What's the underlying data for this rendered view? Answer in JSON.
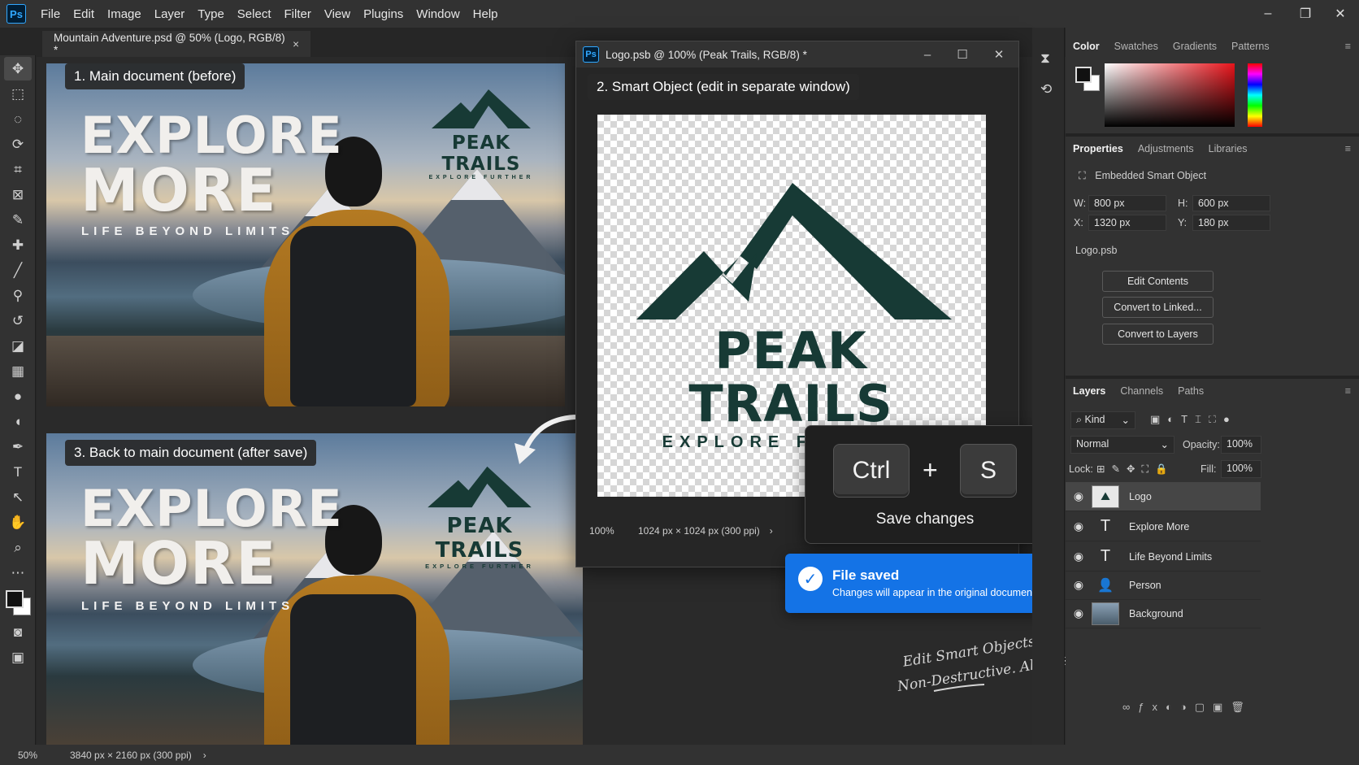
{
  "app": {
    "logo": "Ps",
    "menu": [
      "File",
      "Edit",
      "Image",
      "Layer",
      "Type",
      "Select",
      "Filter",
      "View",
      "Plugins",
      "Window",
      "Help"
    ],
    "window_controls": {
      "minimize": "–",
      "restore": "❐",
      "close": "✕"
    }
  },
  "main_doc": {
    "tab_title": "Mountain Adventure.psd @ 50% (Logo, RGB/8) *",
    "tab_close": "×",
    "label_before": "1. Main document (before)",
    "label_after": "3. Back to main document (after save)",
    "headline_1": "EXPLORE",
    "headline_2": "MORE",
    "tagline": "LIFE BEYOND LIMITS",
    "logo_title": "PEAK TRAILS",
    "logo_sub": "EXPLORE FURTHER",
    "status_zoom": "50%",
    "status_size": "3840 px × 2160 px (300 ppi)",
    "status_arrow": "›"
  },
  "smart_object": {
    "title": "Logo.psb @ 100% (Peak Trails, RGB/8) *",
    "label": "2. Smart Object (edit in separate window)",
    "logo_title": "PEAK TRAILS",
    "logo_sub": "EXPLORE FURTHER",
    "status_zoom": "100%",
    "status_size": "1024 px × 1024 px (300 ppi)",
    "status_arrow": "›",
    "controls": {
      "minimize": "–",
      "restore": "☐",
      "close": "✕"
    }
  },
  "shortcut": {
    "key1": "Ctrl",
    "plus": "+",
    "key2": "S",
    "caption": "Save changes"
  },
  "toast": {
    "title": "File saved",
    "message": "Changes will appear in the original document.",
    "icon": "check-icon",
    "color": "#1473e6"
  },
  "handwriting": {
    "line1": "Edit Smart Objects",
    "line2": "Non-Destructive. Always."
  },
  "panels": {
    "color_tabs": [
      "Color",
      "Swatches",
      "Gradients",
      "Patterns"
    ],
    "props_tabs": [
      "Properties",
      "Adjustments",
      "Libraries"
    ],
    "props": {
      "type": "Embedded Smart Object",
      "w_label": "W:",
      "w_value": "800 px",
      "h_label": "H:",
      "h_value": "600 px",
      "x_label": "X:",
      "x_value": "1320 px",
      "y_label": "Y:",
      "y_value": "180 px",
      "file": "Logo.psb",
      "buttons": [
        "Edit Contents",
        "Convert to Linked...",
        "Convert to Layers"
      ]
    },
    "layers_tabs": [
      "Layers",
      "Channels",
      "Paths"
    ],
    "layers": {
      "filter_kind": "Kind",
      "blend_mode": "Normal",
      "opacity_label": "Opacity:",
      "opacity_value": "100%",
      "lock_label": "Lock:",
      "fill_label": "Fill:",
      "fill_value": "100%",
      "items": [
        {
          "name": "Logo",
          "kind": "smart"
        },
        {
          "name": "Explore More",
          "kind": "text"
        },
        {
          "name": "Life Beyond Limits",
          "kind": "text"
        },
        {
          "name": "Person",
          "kind": "image"
        },
        {
          "name": "Background",
          "kind": "image"
        }
      ]
    },
    "menu_glyph": "≡"
  },
  "colors": {
    "accent": "#1473e6",
    "logo_green": "#173a35",
    "panel_bg": "#323232",
    "app_bg": "#262626"
  }
}
